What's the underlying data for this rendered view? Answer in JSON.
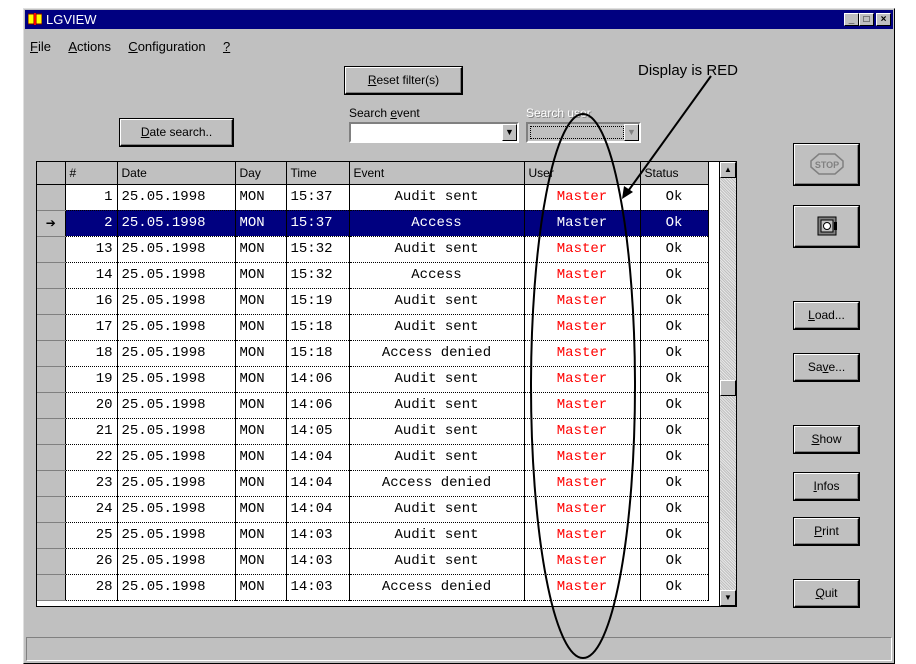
{
  "window": {
    "title": "LGVIEW"
  },
  "menu": [
    {
      "prefix": "",
      "ul": "F",
      "rest": "ile"
    },
    {
      "prefix": "",
      "ul": "A",
      "rest": "ctions"
    },
    {
      "prefix": "",
      "ul": "C",
      "rest": "onfiguration"
    },
    {
      "prefix": "",
      "ul": "?",
      "rest": ""
    }
  ],
  "filters": {
    "reset_ul": "R",
    "reset_rest": "eset filter(s)",
    "date_ul": "D",
    "date_rest": "ate search..",
    "search_event_label_pre": "Search ",
    "search_event_label_ul": "e",
    "search_event_label_post": "vent",
    "search_event_value": "",
    "search_user_label": "Search user",
    "search_user_value": ""
  },
  "table": {
    "columns": [
      "#",
      "Date",
      "Day",
      "Time",
      "Event",
      "User",
      "Status"
    ],
    "rows": [
      {
        "num": "1",
        "date": "25.05.1998",
        "day": "MON",
        "time": "15:37",
        "event": "Audit sent",
        "user": "Master",
        "status": "Ok"
      },
      {
        "num": "2",
        "date": "25.05.1998",
        "day": "MON",
        "time": "15:37",
        "event": "Access",
        "user": "Master",
        "status": "Ok"
      },
      {
        "num": "13",
        "date": "25.05.1998",
        "day": "MON",
        "time": "15:32",
        "event": "Audit sent",
        "user": "Master",
        "status": "Ok"
      },
      {
        "num": "14",
        "date": "25.05.1998",
        "day": "MON",
        "time": "15:32",
        "event": "Access",
        "user": "Master",
        "status": "Ok"
      },
      {
        "num": "16",
        "date": "25.05.1998",
        "day": "MON",
        "time": "15:19",
        "event": "Audit sent",
        "user": "Master",
        "status": "Ok"
      },
      {
        "num": "17",
        "date": "25.05.1998",
        "day": "MON",
        "time": "15:18",
        "event": "Audit sent",
        "user": "Master",
        "status": "Ok"
      },
      {
        "num": "18",
        "date": "25.05.1998",
        "day": "MON",
        "time": "15:18",
        "event": "Access denied",
        "user": "Master",
        "status": "Ok"
      },
      {
        "num": "19",
        "date": "25.05.1998",
        "day": "MON",
        "time": "14:06",
        "event": "Audit sent",
        "user": "Master",
        "status": "Ok"
      },
      {
        "num": "20",
        "date": "25.05.1998",
        "day": "MON",
        "time": "14:06",
        "event": "Audit sent",
        "user": "Master",
        "status": "Ok"
      },
      {
        "num": "21",
        "date": "25.05.1998",
        "day": "MON",
        "time": "14:05",
        "event": "Audit sent",
        "user": "Master",
        "status": "Ok"
      },
      {
        "num": "22",
        "date": "25.05.1998",
        "day": "MON",
        "time": "14:04",
        "event": "Audit sent",
        "user": "Master",
        "status": "Ok"
      },
      {
        "num": "23",
        "date": "25.05.1998",
        "day": "MON",
        "time": "14:04",
        "event": "Access denied",
        "user": "Master",
        "status": "Ok"
      },
      {
        "num": "24",
        "date": "25.05.1998",
        "day": "MON",
        "time": "14:04",
        "event": "Audit sent",
        "user": "Master",
        "status": "Ok"
      },
      {
        "num": "25",
        "date": "25.05.1998",
        "day": "MON",
        "time": "14:03",
        "event": "Audit sent",
        "user": "Master",
        "status": "Ok"
      },
      {
        "num": "26",
        "date": "25.05.1998",
        "day": "MON",
        "time": "14:03",
        "event": "Audit sent",
        "user": "Master",
        "status": "Ok"
      },
      {
        "num": "28",
        "date": "25.05.1998",
        "day": "MON",
        "time": "14:03",
        "event": "Access denied",
        "user": "Master",
        "status": "Ok"
      }
    ],
    "selected_index": 1
  },
  "buttons": {
    "stop": "STOP",
    "load_ul": "L",
    "load_rest": "oad...",
    "save_pre": "Sa",
    "save_ul": "v",
    "save_rest": "e...",
    "show_ul": "S",
    "show_rest": "how",
    "infos_ul": "I",
    "infos_rest": "nfos",
    "print_ul": "P",
    "print_rest": "rint",
    "quit_ul": "Q",
    "quit_rest": "uit"
  },
  "annotation": {
    "text": "Display is RED"
  },
  "colors": {
    "title_bar": "#000080",
    "selection": "#000080",
    "user_text": "#ff0000",
    "face": "#c0c0c0"
  }
}
